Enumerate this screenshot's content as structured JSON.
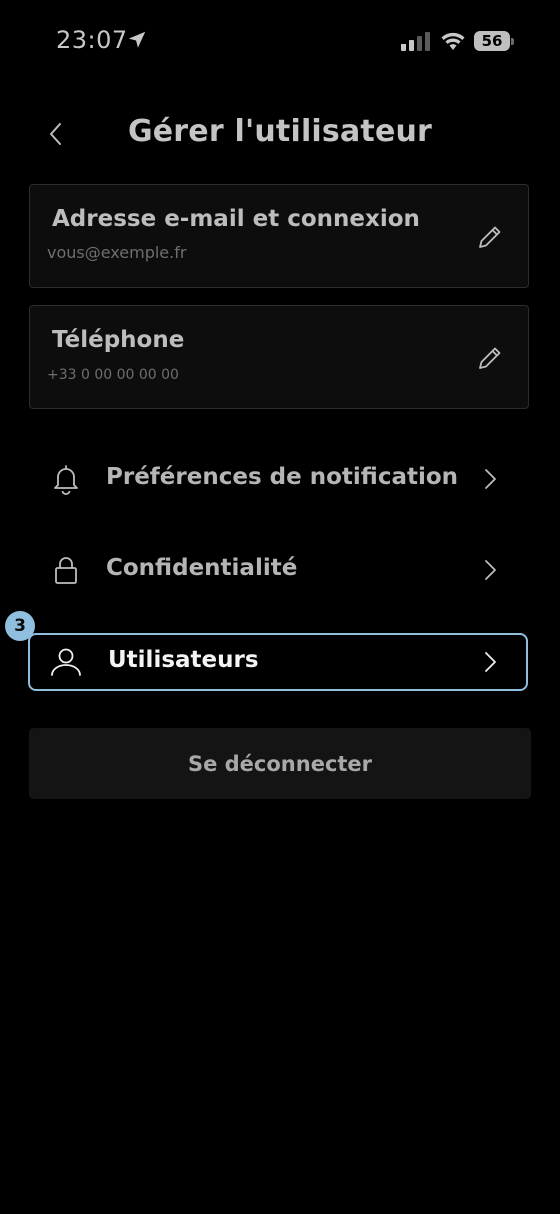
{
  "status_bar": {
    "time": "23:07",
    "battery": "56",
    "icons": [
      "location-arrow-icon",
      "cellular-signal-icon",
      "wifi-icon",
      "battery-icon"
    ]
  },
  "header": {
    "title": "Gérer l'utilisateur",
    "back_icon": "chevron-left-icon"
  },
  "account": {
    "email": {
      "title": "Adresse e-mail et connexion",
      "value": "vous@exemple.fr",
      "icon": "pencil-icon"
    },
    "phone": {
      "title": "Téléphone",
      "value": "+33 0 00 00 00 00",
      "icon": "pencil-icon"
    }
  },
  "menu": {
    "items": [
      {
        "label": "Préférences de notification",
        "icon": "bell-icon"
      },
      {
        "label": "Confidentialité",
        "icon": "lock-icon"
      },
      {
        "label": "Utilisateurs",
        "icon": "user-icon",
        "highlighted": true
      }
    ]
  },
  "annotation": {
    "step": "3",
    "color": "#8fbedf"
  },
  "logout": {
    "label": "Se déconnecter"
  },
  "colors": {
    "background": "#000000",
    "card": "#0d0d0d",
    "logout_button": "#141414",
    "highlight": "#8fbedf"
  }
}
